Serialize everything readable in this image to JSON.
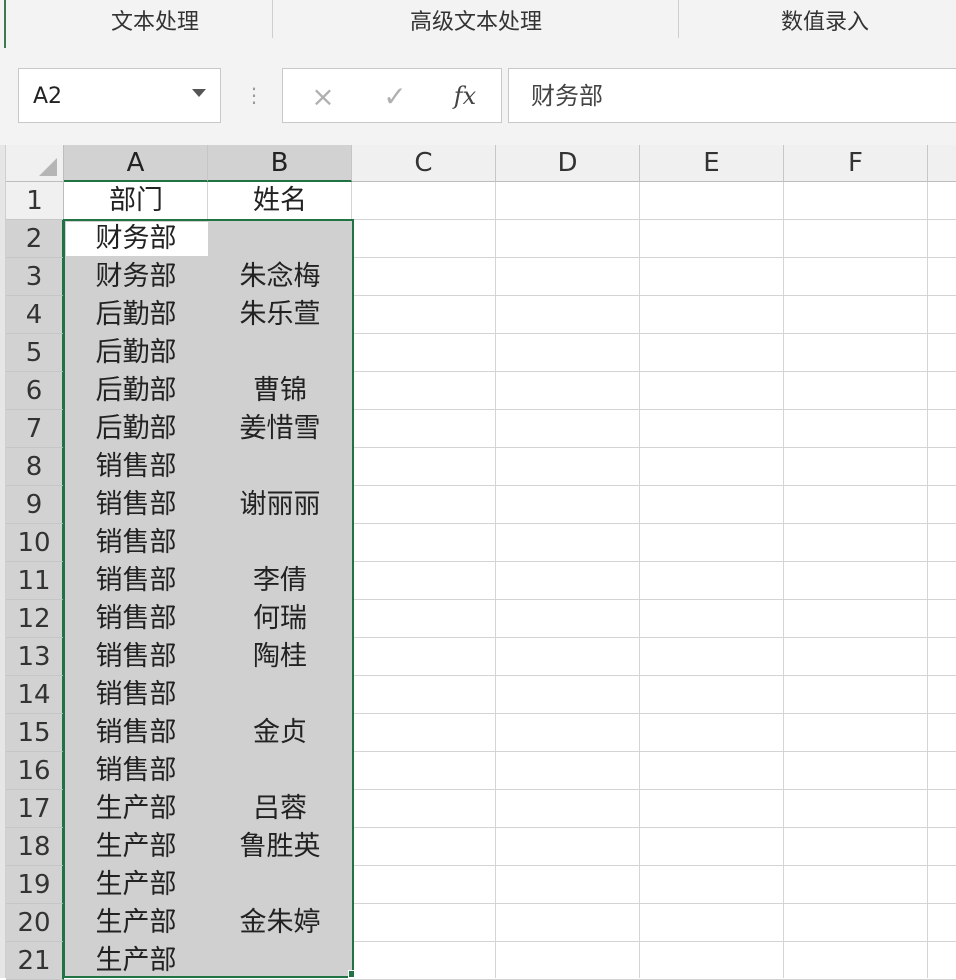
{
  "ribbon": {
    "groups": [
      "文本处理",
      "高级文本处理",
      "数值录入"
    ]
  },
  "formula_bar": {
    "name_box": "A2",
    "separator": "⋮",
    "cancel_icon": "×",
    "enter_icon": "✓",
    "fx_label": "fx",
    "content": "财务部"
  },
  "sheet": {
    "columns": [
      "A",
      "B",
      "C",
      "D",
      "E",
      "F"
    ],
    "rows": [
      "1",
      "2",
      "3",
      "4",
      "5",
      "6",
      "7",
      "8",
      "9",
      "10",
      "11",
      "12",
      "13",
      "14",
      "15",
      "16",
      "17",
      "18",
      "19",
      "20",
      "21"
    ],
    "header_row": [
      "部门",
      "姓名"
    ],
    "data": [
      [
        "财务部",
        ""
      ],
      [
        "财务部",
        "朱念梅"
      ],
      [
        "后勤部",
        "朱乐萱"
      ],
      [
        "后勤部",
        ""
      ],
      [
        "后勤部",
        "曹锦"
      ],
      [
        "后勤部",
        "姜惜雪"
      ],
      [
        "销售部",
        ""
      ],
      [
        "销售部",
        "谢丽丽"
      ],
      [
        "销售部",
        ""
      ],
      [
        "销售部",
        "李倩"
      ],
      [
        "销售部",
        "何瑞"
      ],
      [
        "销售部",
        "陶桂"
      ],
      [
        "销售部",
        ""
      ],
      [
        "销售部",
        "金贞"
      ],
      [
        "销售部",
        ""
      ],
      [
        "生产部",
        "吕蓉"
      ],
      [
        "生产部",
        "鲁胜英"
      ],
      [
        "生产部",
        ""
      ],
      [
        "生产部",
        "金朱婷"
      ],
      [
        "生产部",
        ""
      ]
    ]
  },
  "colors": {
    "selection_border": "#217346",
    "selection_fill": "#d0d0d0",
    "header_fill": "#f0f0f0"
  }
}
